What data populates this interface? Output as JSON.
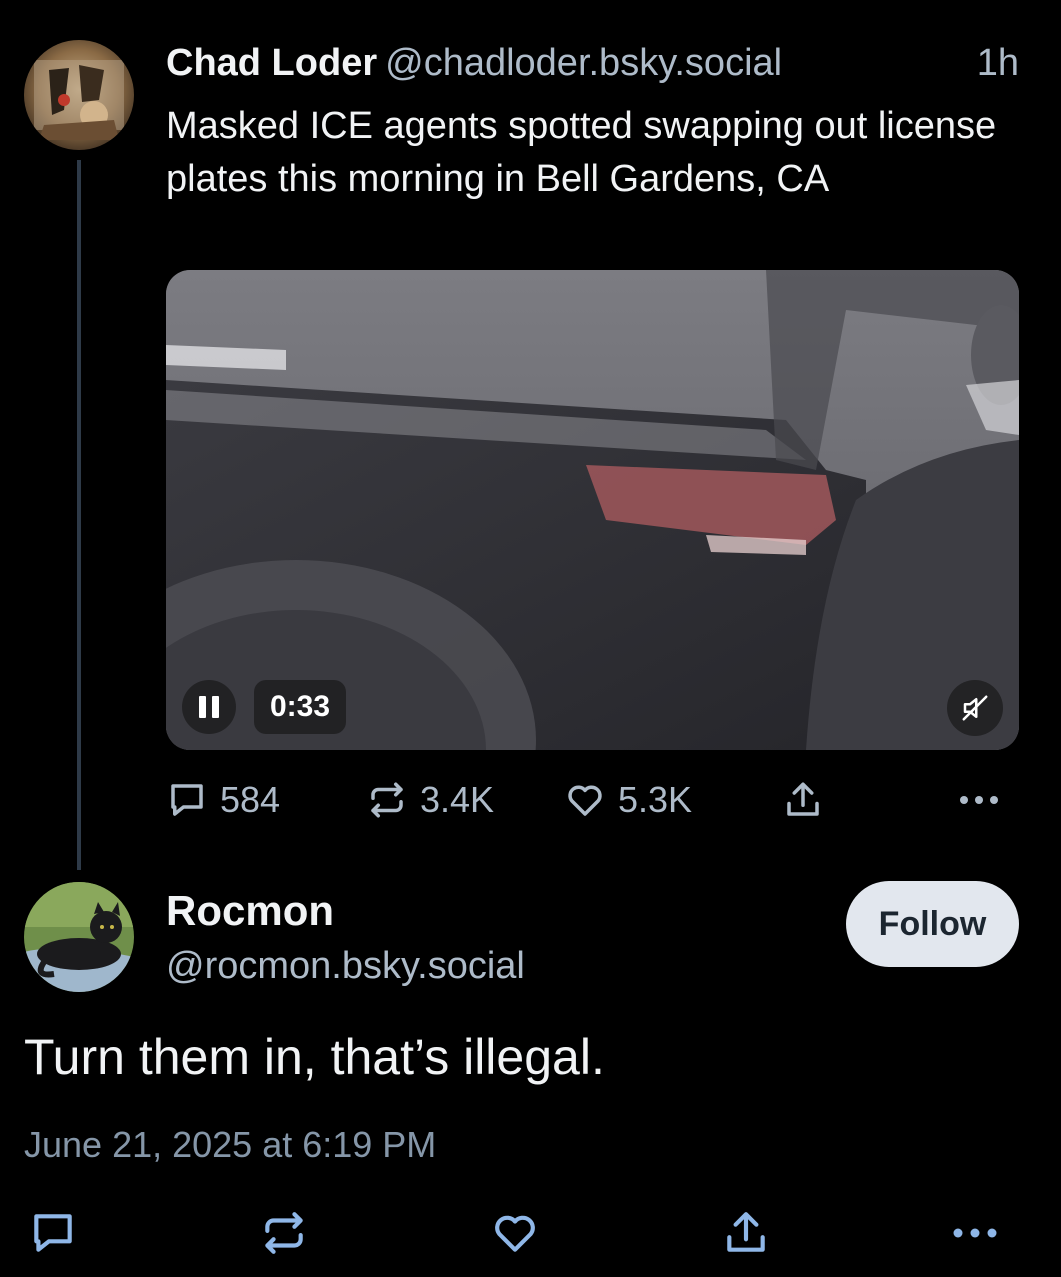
{
  "parent_post": {
    "author_name": "Chad Loder",
    "author_handle": "@chadloder.bsky.social",
    "time": "1h",
    "text": "Masked ICE agents spotted swapping out license plates this morning in Bell Gardens, CA",
    "video": {
      "elapsed": "0:33",
      "state": "playing",
      "muted": true
    },
    "stats": {
      "replies": "584",
      "reposts": "3.4K",
      "likes": "5.3K"
    }
  },
  "reply_post": {
    "author_name": "Rocmon",
    "author_handle": "@rocmon.bsky.social",
    "follow_label": "Follow",
    "text": "Turn them in, that’s illegal.",
    "date": "June 21, 2025 at 6:19 PM"
  },
  "icons": [
    "reply-icon",
    "repost-icon",
    "like-icon",
    "share-icon",
    "more-icon",
    "pause-icon",
    "mute-icon"
  ],
  "colors": {
    "background": "#000000",
    "text": "#f1f3f5",
    "muted_text": "#aebbc9",
    "thread_line": "#2e3a48",
    "follow_bg": "#e2e7ee",
    "action_icon_blue": "#8fb7e8"
  }
}
